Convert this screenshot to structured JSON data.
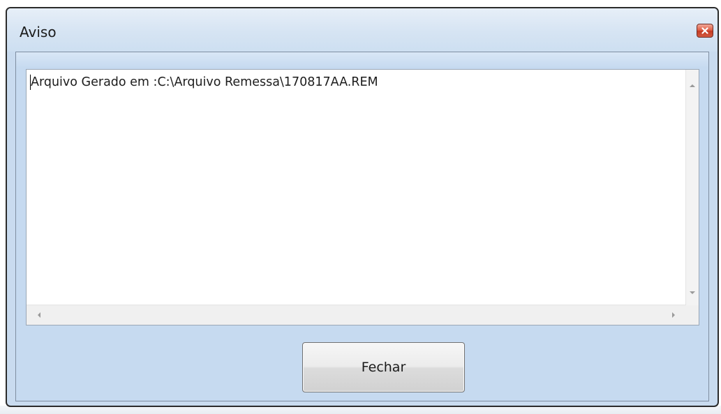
{
  "window": {
    "title": "Aviso",
    "close_icon": "close-icon"
  },
  "memo": {
    "text": "Arquivo Gerado em :C:\\Arquivo Remessa\\170817AA.REM"
  },
  "buttons": {
    "close_label": "Fechar"
  },
  "colors": {
    "dialog_background": "#c9dbef",
    "close_button_red": "#d4593f"
  }
}
